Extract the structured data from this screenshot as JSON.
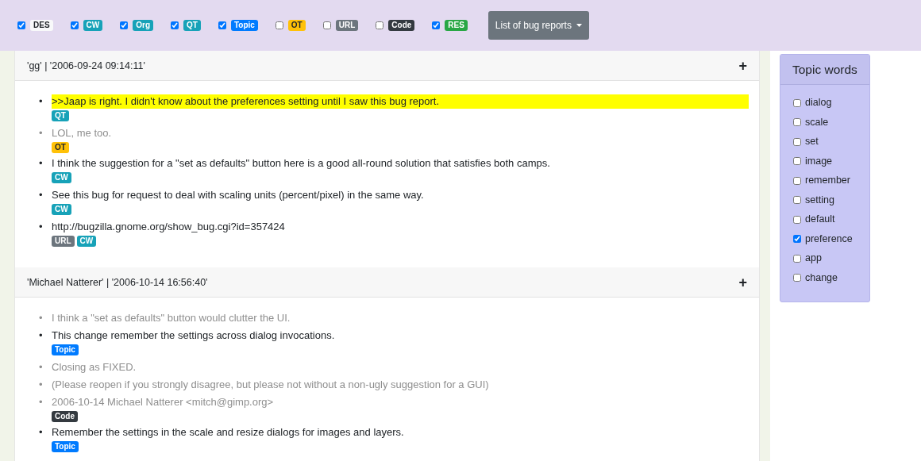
{
  "filters": [
    {
      "label": "DES",
      "checked": true,
      "color": "#f8f9fa"
    },
    {
      "label": "CW",
      "checked": true,
      "color": "#17a2b8"
    },
    {
      "label": "Org",
      "checked": true,
      "color": "#17a2b8"
    },
    {
      "label": "QT",
      "checked": true,
      "color": "#17a2b8"
    },
    {
      "label": "Topic",
      "checked": true,
      "color": "#007bff"
    },
    {
      "label": "OT",
      "checked": false,
      "color": "#ffc107"
    },
    {
      "label": "URL",
      "checked": false,
      "color": "#6c757d"
    },
    {
      "label": "Code",
      "checked": false,
      "color": "#343a40"
    },
    {
      "label": "RES",
      "checked": true,
      "color": "#28a745"
    }
  ],
  "dropdown": {
    "label": "List of bug reports"
  },
  "comments": [
    {
      "header": "'gg' | '2006-09-24 09:14:11'",
      "expand": "+",
      "sentences": [
        {
          "bullet": "•",
          "text": ">>Jaap is right. I didn't know about the preferences setting until I saw this bug report.",
          "highlighted": true,
          "faded": false,
          "tags": [
            {
              "label": "QT",
              "color": "#17a2b8"
            }
          ]
        },
        {
          "bullet": "•",
          "text": "LOL, me too.",
          "highlighted": false,
          "faded": true,
          "tags": [
            {
              "label": "OT",
              "color": "#ffc107"
            }
          ]
        },
        {
          "bullet": "•",
          "text": "I think the suggestion for a \"set as defaults\" button here is a good all-round solution that satisfies both camps.",
          "highlighted": false,
          "faded": false,
          "tags": [
            {
              "label": "CW",
              "color": "#17a2b8"
            }
          ]
        },
        {
          "bullet": "•",
          "text": "See this bug for request to deal with scaling units (percent/pixel) in the same way.",
          "highlighted": false,
          "faded": false,
          "tags": [
            {
              "label": "CW",
              "color": "#17a2b8"
            }
          ]
        },
        {
          "bullet": "•",
          "text": "http://bugzilla.gnome.org/show_bug.cgi?id=357424",
          "highlighted": false,
          "faded": false,
          "tags": [
            {
              "label": "URL",
              "color": "#6c757d"
            },
            {
              "label": "CW",
              "color": "#17a2b8"
            }
          ]
        }
      ]
    },
    {
      "header": "'Michael Natterer' | '2006-10-14 16:56:40'",
      "expand": "+",
      "sentences": [
        {
          "bullet": "•",
          "text": "I think a \"set as defaults\" button would clutter the UI.",
          "highlighted": false,
          "faded": true
        },
        {
          "bullet": "•",
          "text": "This change remember the settings across dialog invocations.",
          "highlighted": false,
          "faded": false,
          "tags": [
            {
              "label": "Topic",
              "color": "#007bff"
            }
          ]
        },
        {
          "bullet": "•",
          "text": "Closing as FIXED.",
          "highlighted": false,
          "faded": true
        },
        {
          "bullet": "•",
          "text": "(Please reopen if you strongly disagree, but please not without a non-ugly suggestion for a GUI)",
          "highlighted": false,
          "faded": true
        },
        {
          "bullet": "•",
          "text": "2006-10-14 Michael Natterer <mitch@gimp.org>",
          "highlighted": false,
          "faded": true,
          "tags": [
            {
              "label": "Code",
              "color": "#343a40"
            }
          ]
        },
        {
          "bullet": "•",
          "text": "Remember the settings in the scale and resize dialogs for images and layers.",
          "highlighted": false,
          "faded": false,
          "tags": [
            {
              "label": "Topic",
              "color": "#007bff"
            }
          ]
        }
      ]
    }
  ],
  "topic_words": {
    "title": "Topic words",
    "items": [
      {
        "label": "dialog",
        "checked": false
      },
      {
        "label": "scale",
        "checked": false
      },
      {
        "label": "set",
        "checked": false
      },
      {
        "label": "image",
        "checked": false
      },
      {
        "label": "remember",
        "checked": false
      },
      {
        "label": "setting",
        "checked": false
      },
      {
        "label": "default",
        "checked": false
      },
      {
        "label": "preference",
        "checked": true
      },
      {
        "label": "app",
        "checked": false
      },
      {
        "label": "change",
        "checked": false
      }
    ]
  }
}
